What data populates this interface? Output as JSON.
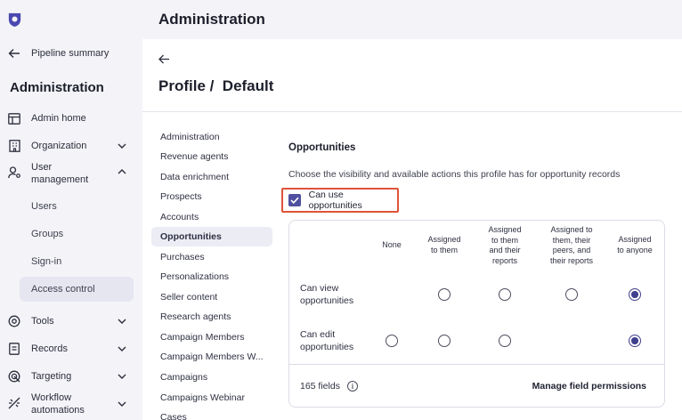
{
  "sidebar": {
    "back_label": "Pipeline summary",
    "title": "Administration",
    "items": [
      {
        "label": "Admin home",
        "icon": "layout-icon"
      },
      {
        "label": "Organization",
        "icon": "building-icon"
      },
      {
        "label": "User management",
        "icon": "user-gear-icon"
      },
      {
        "label": "Tools",
        "icon": "gear-icon"
      },
      {
        "label": "Records",
        "icon": "document-icon"
      },
      {
        "label": "Targeting",
        "icon": "target-icon"
      },
      {
        "label": "Workflow automations",
        "icon": "workflow-icon"
      }
    ],
    "user_management_sub": [
      "Users",
      "Groups",
      "Sign-in",
      "Access control"
    ]
  },
  "header": {
    "title": "Administration"
  },
  "page": {
    "title": "Profile /  Default"
  },
  "subnav": {
    "items": [
      "Administration",
      "Revenue agents",
      "Data enrichment",
      "Prospects",
      "Accounts",
      "Opportunities",
      "Purchases",
      "Personalizations",
      "Seller content",
      "Research agents",
      "Campaign Members",
      "Campaign Members W...",
      "Campaigns",
      "Campaigns Webinar",
      "Cases"
    ],
    "active": "Opportunities"
  },
  "section": {
    "title": "Opportunities",
    "description": "Choose the visibility and available actions this profile has for opportunity records",
    "checkbox_label": "Can use opportunities",
    "checkbox_checked": true
  },
  "permissions": {
    "columns": [
      "None",
      "Assigned\nto them",
      "Assigned\nto them\nand their\nreports",
      "Assigned to\nthem, their\npeers, and\ntheir reports",
      "Assigned\nto anyone"
    ],
    "rows": [
      {
        "label": "Can view\nopportunities",
        "options": [
          null,
          false,
          false,
          false,
          true
        ]
      },
      {
        "label": "Can edit\nopportunities",
        "options": [
          false,
          false,
          false,
          null,
          true
        ]
      }
    ],
    "fields_count": "165 fields",
    "manage_label": "Manage field permissions"
  },
  "colors": {
    "accent": "#3f3f8f",
    "highlight_border": "#e0533a",
    "sidebar_bg": "#f4f4f8"
  }
}
